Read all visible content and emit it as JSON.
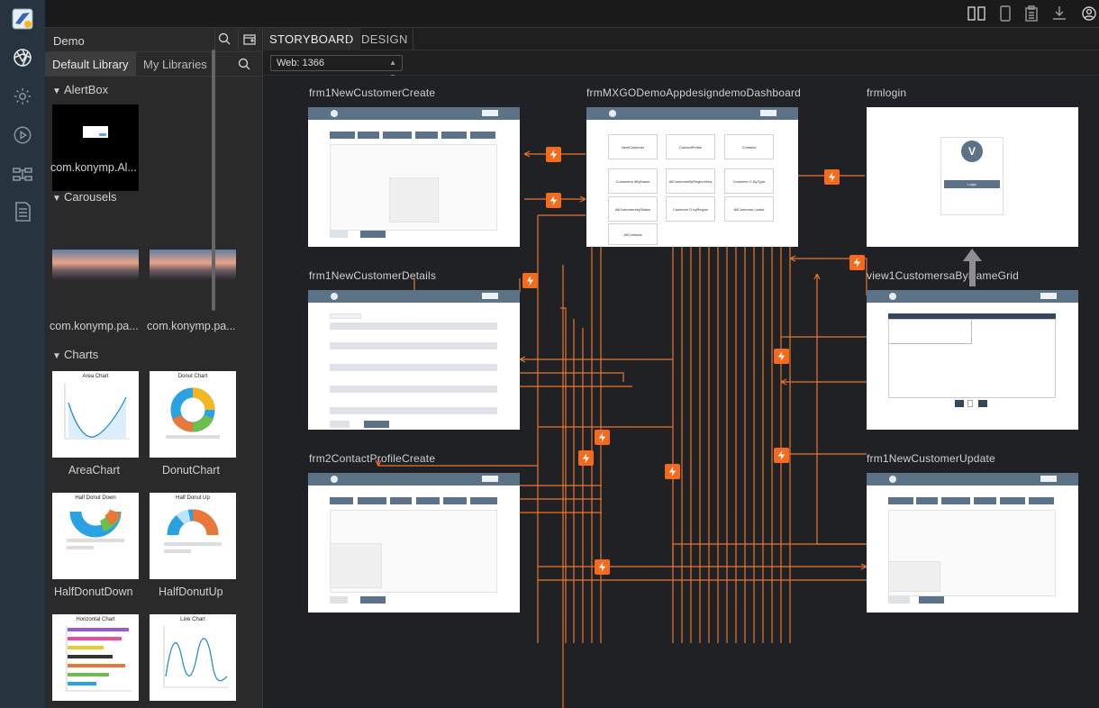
{
  "app": {
    "project_name": "Demo",
    "icons": {
      "logo": "visualizer-logo-icon",
      "rail": [
        "components-icon",
        "settings-gear-icon",
        "preview-play-icon",
        "data-model-icon",
        "page-list-icon"
      ],
      "topbar": [
        "split-view-icon",
        "mobile-device-icon",
        "clipboard-icon",
        "download-icon",
        "account-icon"
      ]
    },
    "accent": "#f36b1c",
    "form_header_color": "#5c7286"
  },
  "library": {
    "tabs": [
      {
        "label": "Default Library",
        "active": true
      },
      {
        "label": "My Libraries",
        "active": false
      }
    ],
    "sections": [
      {
        "title": "AlertBox",
        "items": [
          "com.konymp.Al..."
        ]
      },
      {
        "title": "Carousels",
        "items": [
          "com.konymp.pa...",
          "com.konymp.pa..."
        ]
      },
      {
        "title": "Charts",
        "items": [
          "AreaChart",
          "DonutChart",
          "HalfDonutDown",
          "HalfDonutUp",
          "",
          ""
        ]
      }
    ],
    "chart_titles": [
      "Area Chart",
      "Donut Chart",
      "Half Donut Down",
      "Half Donut Up",
      "Horizontal Chart",
      "Line Chart"
    ]
  },
  "storyboard": {
    "tabs": [
      {
        "label": "STORYBOARD",
        "active": true
      },
      {
        "label": "DESIGN",
        "active": false
      }
    ],
    "web_select": "Web: 1366",
    "forms": [
      {
        "name": "frm1NewCustomerCreate"
      },
      {
        "name": "frmMXGODemoAppdesigndemoDashboard"
      },
      {
        "name": "frmlogin"
      },
      {
        "name": "frm1NewCustomerDetails"
      },
      {
        "name": "view1CustomersaByNameGrid"
      },
      {
        "name": "frm2ContactProfileCreate"
      },
      {
        "name": "frm1NewCustomerUpdate"
      }
    ],
    "dashboard_cards": [
      "NewCustomer",
      "ContactProfile",
      "Contacts",
      "Customers #ByName",
      "AllCustomerByRegionView",
      "Customer C.ByType",
      "AllCustomersbyStatus",
      "Customer D.byRegion",
      "AllCustomer Leads",
      "AllContacts"
    ],
    "login_button": "Login"
  }
}
